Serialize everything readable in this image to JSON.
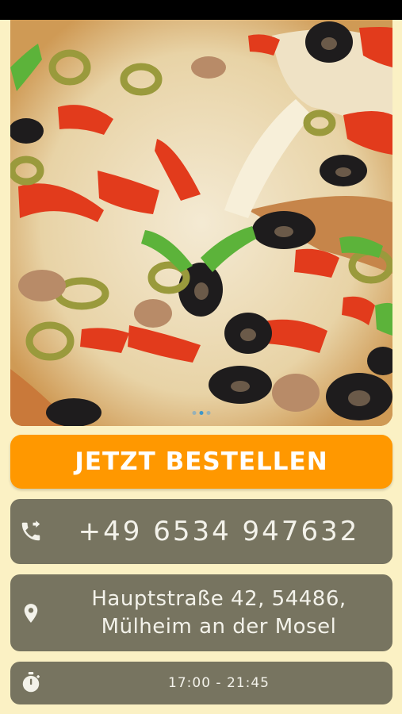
{
  "hero": {
    "image": "pizza-photo",
    "pagination": {
      "count": 3,
      "active": 1
    }
  },
  "order_button": {
    "label": "JETZT BESTELLEN"
  },
  "phone": {
    "icon": "phone-forward-icon",
    "number": "+49 6534 947632"
  },
  "address": {
    "icon": "location-pin-icon",
    "line1": "Hauptstraße 42, 54486,",
    "line2": "Mülheim an der Mosel"
  },
  "hours": {
    "icon": "stopwatch-icon",
    "text": "17:00 - 21:45"
  },
  "colors": {
    "background": "#fbf1c4",
    "accent": "#ff9800",
    "card": "#777460",
    "card_text": "#f3f2ea"
  }
}
